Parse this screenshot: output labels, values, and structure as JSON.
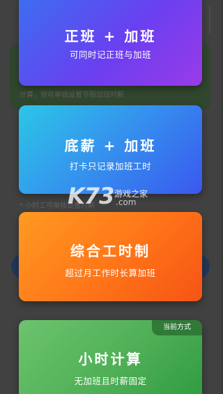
{
  "background": {
    "hint_top": "计算，但可单独设置节假加班时薪",
    "hint_mid": "* 小时工可单独设置时薪"
  },
  "cards": [
    {
      "title": "正班 + 加班",
      "subtitle": "可同时记正班与加班"
    },
    {
      "title": "底薪 + 加班",
      "subtitle": "打卡只记录加班工时"
    },
    {
      "title": "综合工时制",
      "subtitle": "超过月工作时长算加班"
    },
    {
      "title": "小时计算",
      "subtitle": "无加班且时薪固定",
      "badge": "当前方式"
    }
  ],
  "watermark": {
    "logo": "K73",
    "text": "游戏之家",
    "domain": ".com"
  },
  "colors": {
    "card1": "#5a4ff0",
    "card2": "#3590ee",
    "card3": "#ff7418",
    "card4": "#4faf56"
  }
}
